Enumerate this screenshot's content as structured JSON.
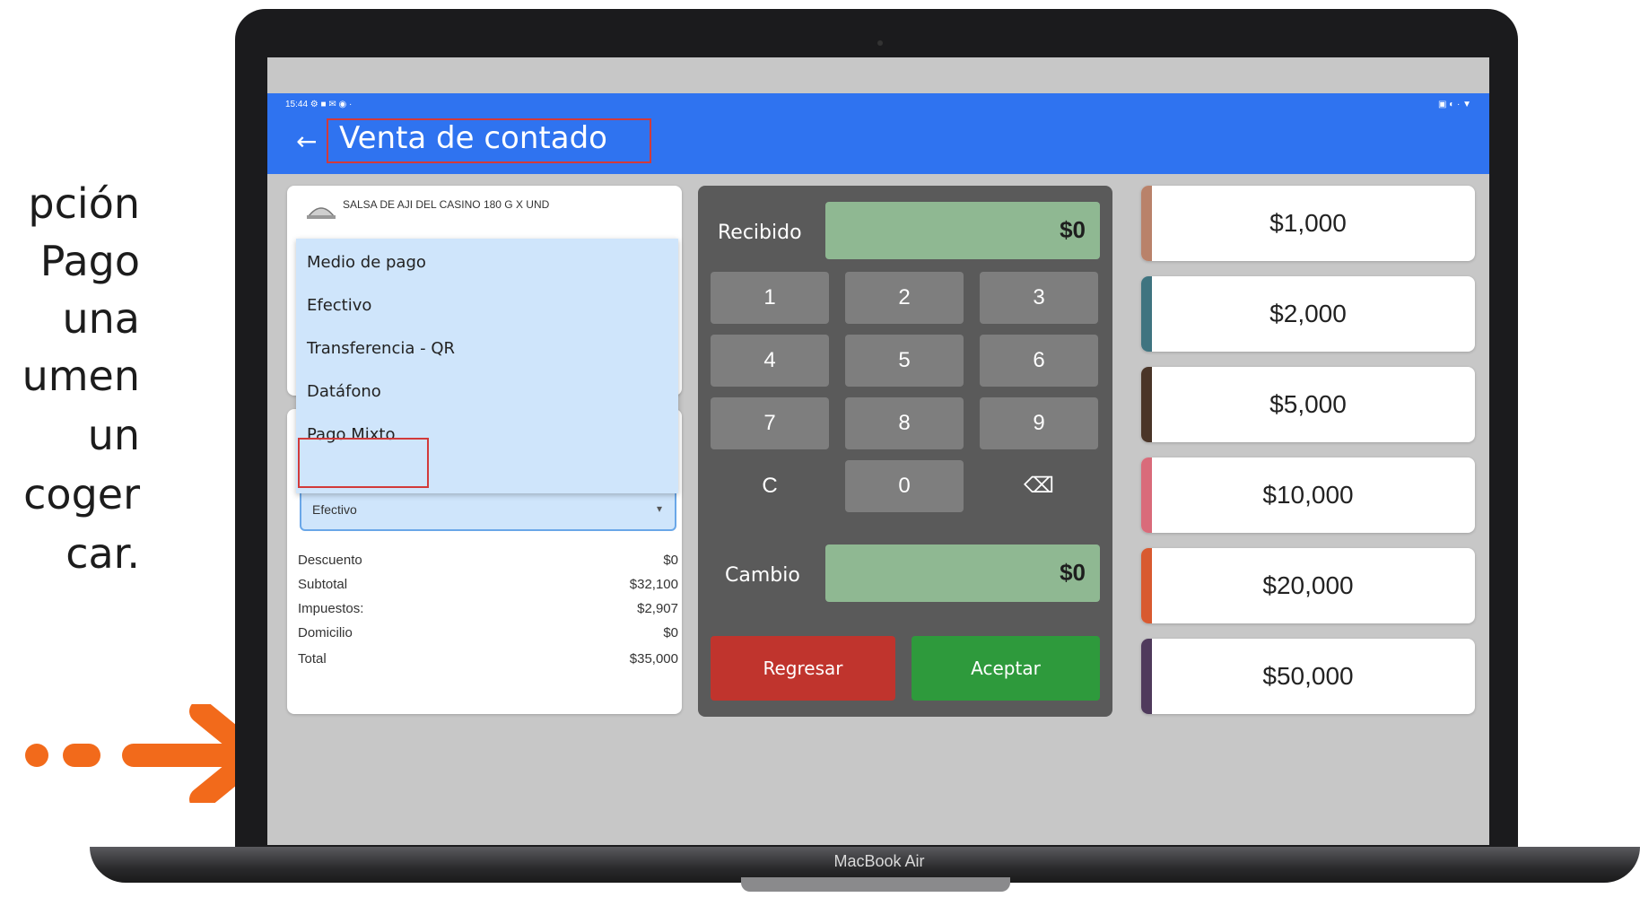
{
  "side_text": [
    "pción",
    "Pago",
    "una",
    "umen",
    "un",
    "coger",
    "car."
  ],
  "device": {
    "label": "MacBook Air"
  },
  "status_bar": {
    "left": "15:44 ⚙ ■ ✉ ◉ ·",
    "right": "▣ ◐ · ▼"
  },
  "header": {
    "back_icon": "arrow-left-icon",
    "title": "Venta de contado"
  },
  "product": {
    "name": "SALSA DE AJI DEL CASINO 180 G X UND"
  },
  "payment_dropdown": {
    "header": "Medio de pago",
    "options": [
      "Efectivo",
      "Transferencia - QR",
      "Datáfono",
      "Pago Mixto"
    ]
  },
  "payment_select": {
    "value": "Efectivo"
  },
  "summary": [
    {
      "label": "Descuento",
      "value": "$0"
    },
    {
      "label": "Subtotal",
      "value": "$32,100"
    },
    {
      "label": "Impuestos:",
      "value": "$2,907"
    },
    {
      "label": "Domicilio",
      "value": "$0"
    },
    {
      "label": "Total",
      "value": "$35,000"
    }
  ],
  "keypad": {
    "received_label": "Recibido",
    "received_value": "$0",
    "keys": [
      "1",
      "2",
      "3",
      "4",
      "5",
      "6",
      "7",
      "8",
      "9",
      "C",
      "0",
      "⌫"
    ],
    "change_label": "Cambio",
    "change_value": "$0",
    "back_button": "Regresar",
    "accept_button": "Aceptar"
  },
  "denominations": [
    {
      "label": "$1,000",
      "color": "#b9826a"
    },
    {
      "label": "$2,000",
      "color": "#3f7480"
    },
    {
      "label": "$5,000",
      "color": "#4a3528"
    },
    {
      "label": "$10,000",
      "color": "#d96b7a"
    },
    {
      "label": "$20,000",
      "color": "#d85a30"
    },
    {
      "label": "$50,000",
      "color": "#4f3a5c"
    }
  ],
  "colors": {
    "appbar": "#2f73f0",
    "highlight": "#d23a3a",
    "arrow": "#f26a1b"
  }
}
